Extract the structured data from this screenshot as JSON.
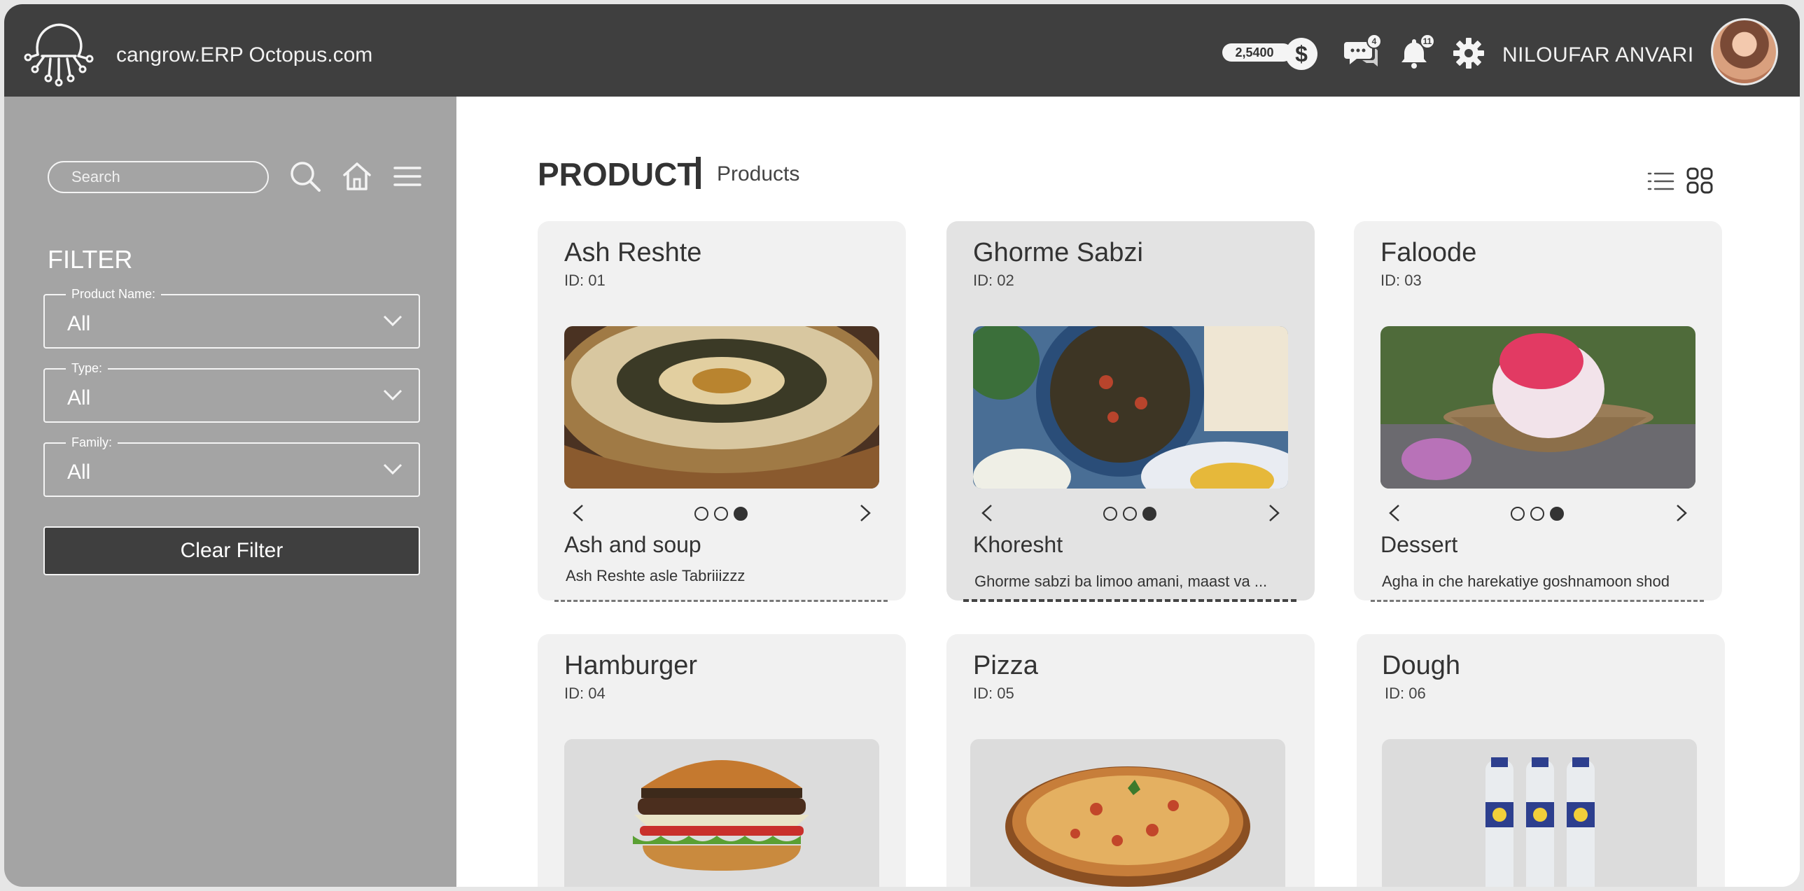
{
  "header": {
    "app_title": "cangrow.ERP Octopus.com",
    "balance": "2,5400",
    "currency_symbol": "$",
    "messages_count": "4",
    "notifications_count": "11",
    "user_name": "NILOUFAR ANVARI"
  },
  "sidebar": {
    "search_placeholder": "Search",
    "filter_title": "FILTER",
    "filters": [
      {
        "label": "Product Name:",
        "value": "All"
      },
      {
        "label": "Type:",
        "value": "All"
      },
      {
        "label": "Family:",
        "value": "All"
      }
    ],
    "clear_label": "Clear Filter"
  },
  "main": {
    "title": "PRODUCT",
    "subtitle": "Products",
    "products": [
      {
        "name": "Ash Reshte",
        "id": "ID: 01",
        "category": "Ash and soup",
        "description": "Ash Reshte asle Tabriiizzz",
        "active_slide": 3
      },
      {
        "name": "Ghorme Sabzi",
        "id": "ID: 02",
        "category": "Khoresht",
        "description": "Ghorme sabzi ba limoo amani, maast va ...",
        "active_slide": 3
      },
      {
        "name": "Faloode",
        "id": "ID: 03",
        "category": "Dessert",
        "description": "Agha in che harekatiye goshnamoon shod",
        "active_slide": 3
      },
      {
        "name": "Hamburger",
        "id": "ID: 04"
      },
      {
        "name": "Pizza",
        "id": "ID: 05"
      },
      {
        "name": "Dough",
        "id": "ID: 06"
      }
    ]
  },
  "colors": {
    "topbar": "#3f3f3f",
    "sidebar": "#a4a4a4",
    "card": "#f1f1f1",
    "card_active": "#e3e3e3"
  }
}
